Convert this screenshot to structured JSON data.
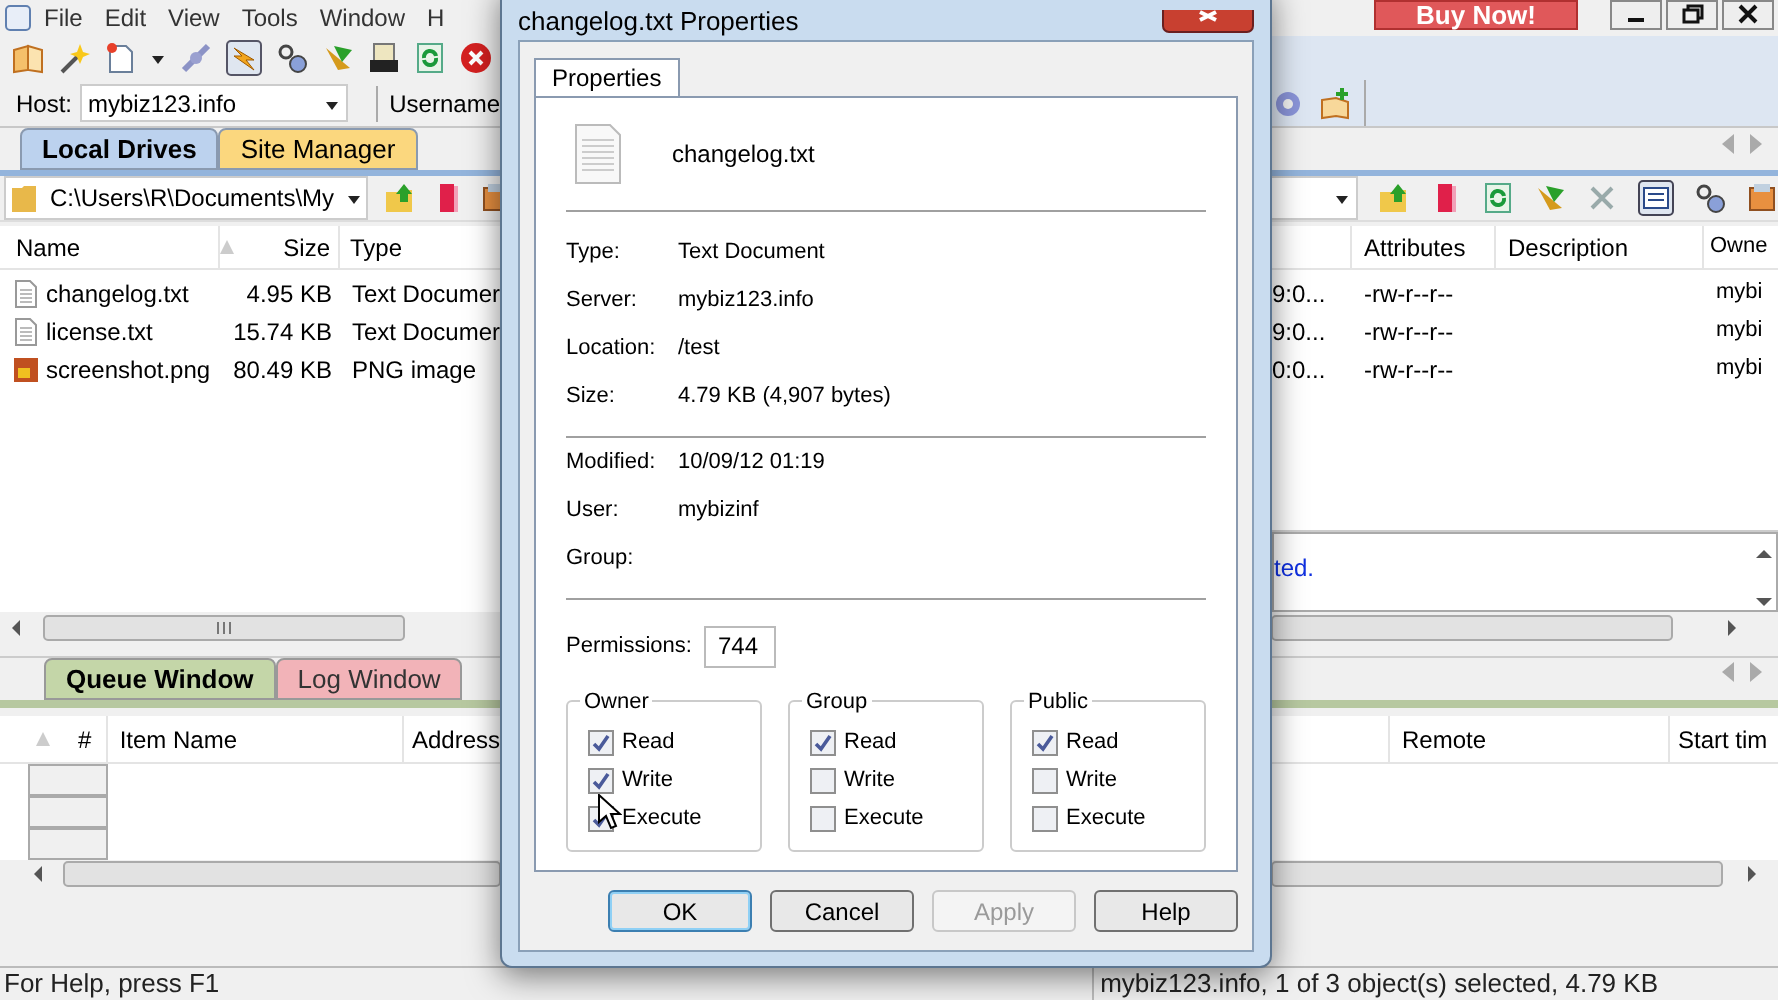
{
  "app": {
    "menu": [
      "File",
      "Edit",
      "View",
      "Tools",
      "Window",
      "H"
    ],
    "buy_button": "Buy Now!",
    "host": {
      "label": "Host:",
      "value": "mybiz123.info"
    },
    "username_label": "Username",
    "tabs": [
      {
        "label": "Local Drives",
        "selected": true
      },
      {
        "label": "Site Manager",
        "selected": false
      }
    ],
    "local_pane": {
      "path": "C:\\Users\\R\\Documents\\My",
      "columns": [
        "Name",
        "Size",
        "Type"
      ],
      "rows": [
        {
          "name": "changelog.txt",
          "size": "4.95 KB",
          "type": "Text Documer",
          "kind": "text"
        },
        {
          "name": "license.txt",
          "size": "15.74 KB",
          "type": "Text Documer",
          "kind": "text"
        },
        {
          "name": "screenshot.png",
          "size": "80.49 KB",
          "type": "PNG image",
          "kind": "image"
        }
      ]
    },
    "remote_pane": {
      "columns": [
        "Attributes",
        "Description",
        "Owne"
      ],
      "rows": [
        {
          "column_1": "9:0...",
          "attributes": "-rw-r--r--",
          "owner": "mybi"
        },
        {
          "column_1": "9:0...",
          "attributes": "-rw-r--r--",
          "owner": "mybi"
        },
        {
          "column_1": "0:0...",
          "attributes": "-rw-r--r--",
          "owner": "mybi"
        }
      ]
    },
    "log_text": "ted.",
    "queue_tabs": [
      {
        "label": "Queue Window",
        "selected": true
      },
      {
        "label": "Log Window",
        "selected": false
      }
    ],
    "queue_columns": {
      "left": [
        "#",
        "Item Name",
        "Address"
      ],
      "right": [
        "Remote",
        "Start tim"
      ]
    },
    "status_bar": [
      "For Help, press F1",
      "mybiz123.info, 1 of 3 object(s) selected, 4.79 KB"
    ]
  },
  "dialog": {
    "title": "changelog.txt Properties",
    "tab": "Properties",
    "file_name": "changelog.txt",
    "info": [
      {
        "label": "Type:",
        "value": "Text Document"
      },
      {
        "label": "Server:",
        "value": "mybiz123.info"
      },
      {
        "label": "Location:",
        "value": "/test"
      },
      {
        "label": "Size:",
        "value": "4.79 KB (4,907 bytes)"
      }
    ],
    "ownership": [
      {
        "label": "Modified:",
        "value": "10/09/12 01:19"
      },
      {
        "label": "User:",
        "value": "mybizinf"
      },
      {
        "label": "Group:"
      }
    ],
    "permissions": {
      "label": "Permissions:",
      "value": "744"
    },
    "groups": [
      {
        "title": "Owner",
        "options": [
          {
            "label": "Read",
            "checked": true
          },
          {
            "label": "Write",
            "checked": true
          },
          {
            "label": "Execute",
            "checked": true
          }
        ]
      },
      {
        "title": "Group",
        "options": [
          {
            "label": "Read",
            "checked": true
          },
          {
            "label": "Write",
            "checked": false
          },
          {
            "label": "Execute",
            "checked": false
          }
        ]
      },
      {
        "title": "Public",
        "options": [
          {
            "label": "Read",
            "checked": true
          },
          {
            "label": "Write",
            "checked": false
          },
          {
            "label": "Execute",
            "checked": false
          }
        ]
      }
    ],
    "buttons": [
      {
        "label": "OK",
        "default": true,
        "disabled": false
      },
      {
        "label": "Cancel",
        "default": false,
        "disabled": false
      },
      {
        "label": "Apply",
        "default": false,
        "disabled": true
      },
      {
        "label": "Help",
        "default": false,
        "disabled": false
      }
    ]
  }
}
